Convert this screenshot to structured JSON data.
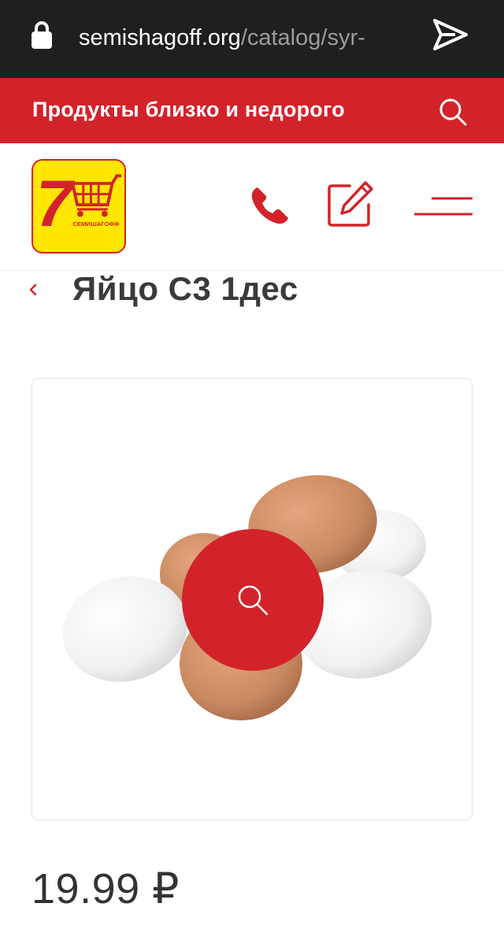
{
  "browser": {
    "url_domain": "semishagoff.org",
    "url_path": "/catalog/syr-",
    "lock_icon": "lock-icon",
    "send_icon": "send-icon"
  },
  "banner": {
    "tagline": "Продукты близко и недорого",
    "search_icon": "search-icon",
    "color": "#d2232a"
  },
  "header": {
    "logo_text": "СЕМИШАГОФФ",
    "logo_digit": "7",
    "icons": [
      "phone-icon",
      "edit-icon",
      "menu-icon"
    ]
  },
  "product": {
    "title": "Яйцо С3 1дес",
    "price": "19.99 ₽",
    "zoom_icon": "search-icon"
  }
}
